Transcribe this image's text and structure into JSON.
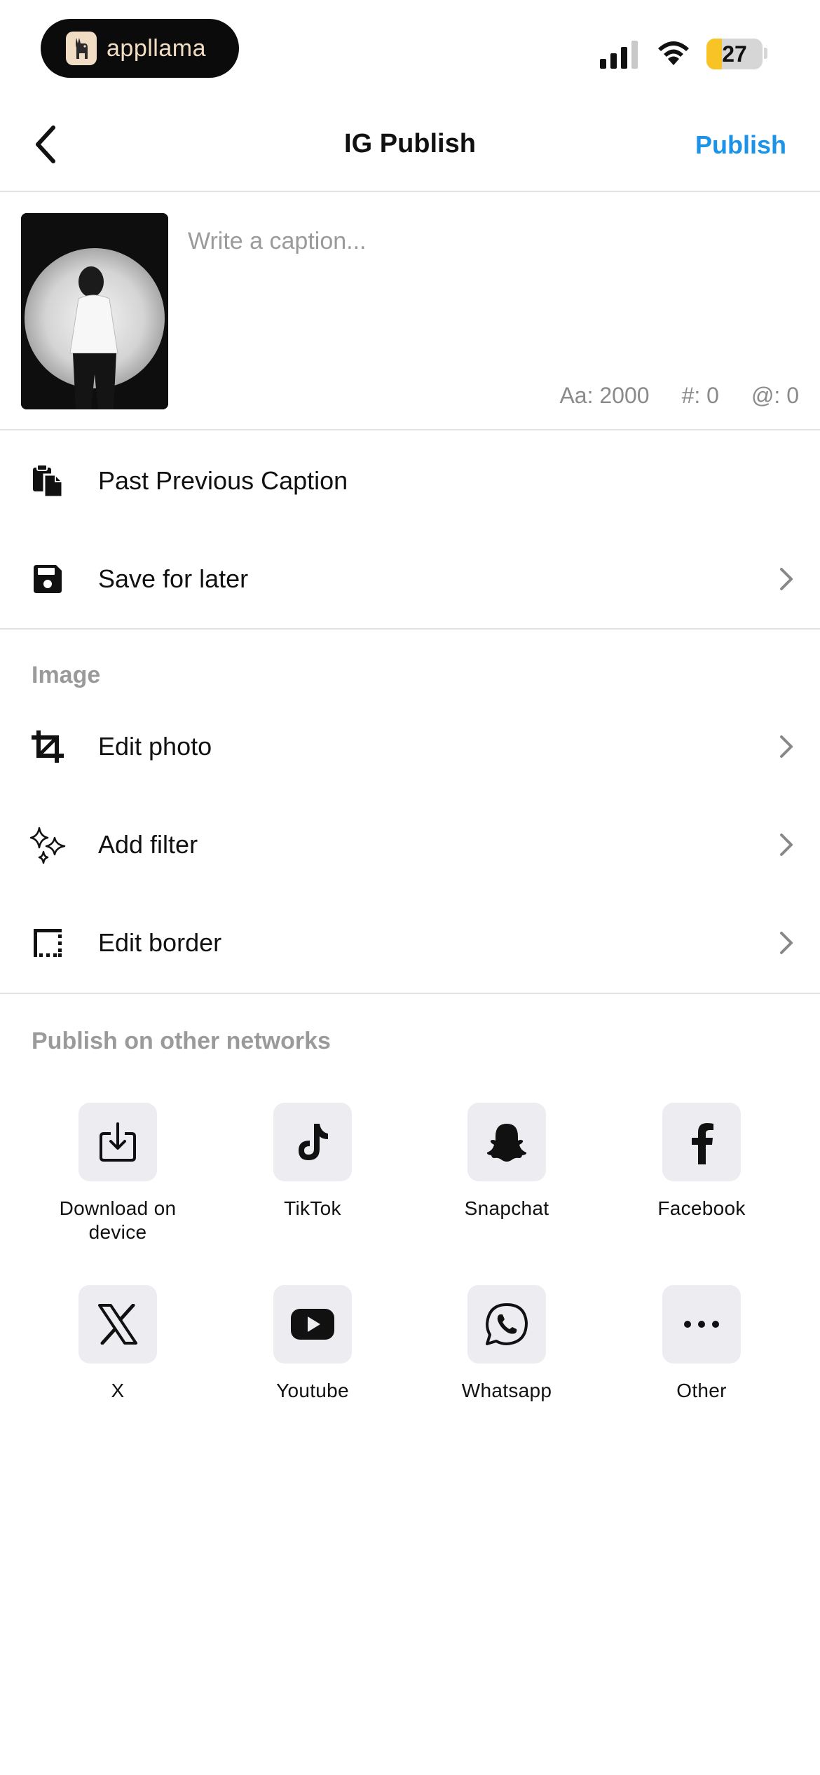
{
  "status_bar": {
    "app_badge": "appllama",
    "battery_level": "27",
    "battery_fraction": 0.27
  },
  "nav": {
    "title": "IG Publish",
    "publish_label": "Publish"
  },
  "caption": {
    "placeholder": "Write a caption...",
    "value": "",
    "counters": [
      "Aa: 2000",
      "#: 0",
      "@: 0"
    ]
  },
  "actions": [
    {
      "label": "Past Previous Caption",
      "icon": "clipboard-icon"
    },
    {
      "label": "Save for later",
      "icon": "floppy-disk-icon"
    }
  ],
  "image_section": {
    "title": "Image",
    "items": [
      {
        "label": "Edit photo",
        "icon": "crop-icon"
      },
      {
        "label": "Add filter",
        "icon": "sparkles-icon"
      },
      {
        "label": "Edit border",
        "icon": "border-icon"
      }
    ]
  },
  "networks_section": {
    "title": "Publish on other networks",
    "items": [
      {
        "label": "Download on device",
        "icon": "download-icon"
      },
      {
        "label": "TikTok",
        "icon": "tiktok-icon"
      },
      {
        "label": "Snapchat",
        "icon": "snapchat-icon"
      },
      {
        "label": "Facebook",
        "icon": "facebook-icon"
      },
      {
        "label": "X",
        "icon": "x-icon"
      },
      {
        "label": "Youtube",
        "icon": "youtube-icon"
      },
      {
        "label": "Whatsapp",
        "icon": "whatsapp-icon"
      },
      {
        "label": "Other",
        "icon": "more-icon"
      }
    ]
  },
  "colors": {
    "accent": "#1a93e8",
    "battery": "#f7c325",
    "tile_bg": "#ececf1",
    "muted_text": "#9a9a9a"
  }
}
